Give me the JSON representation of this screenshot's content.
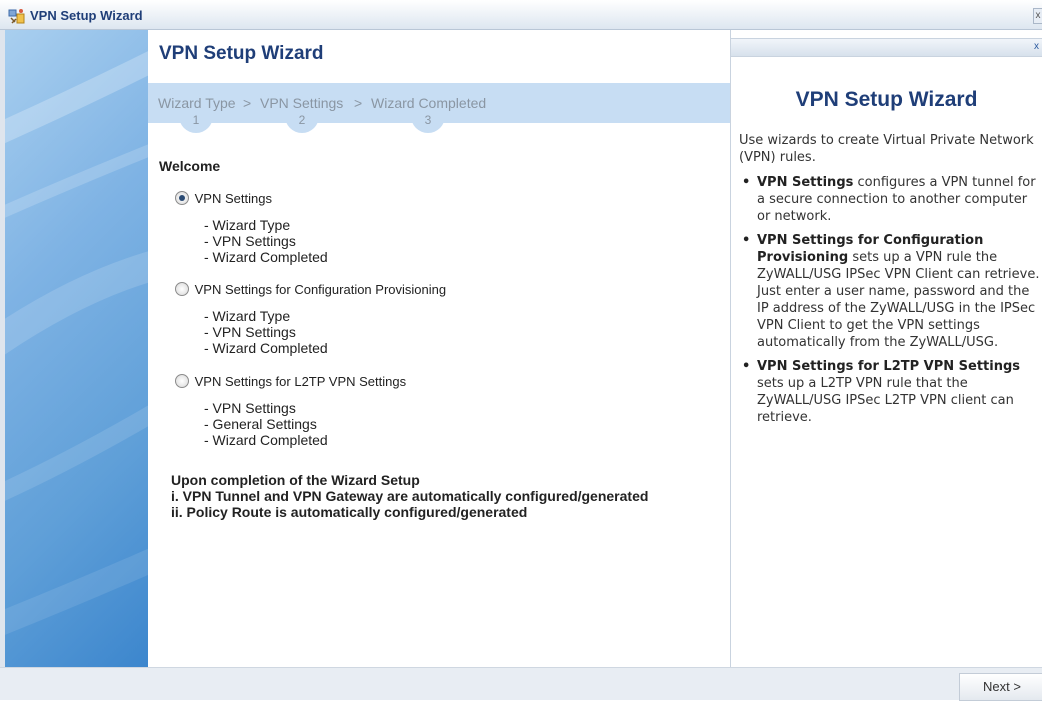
{
  "window": {
    "title": "VPN Setup Wizard",
    "close_glyph": "x"
  },
  "main": {
    "title": "VPN Setup Wizard",
    "steps": [
      {
        "label": "Wizard Type",
        "number": "1"
      },
      {
        "label": "VPN Settings",
        "number": "2"
      },
      {
        "label": "Wizard Completed",
        "number": "3"
      }
    ],
    "step_separator": ">",
    "welcome": "Welcome",
    "options": [
      {
        "label": "VPN Settings",
        "checked": true,
        "items": [
          "- Wizard Type",
          "- VPN Settings",
          "- Wizard Completed"
        ]
      },
      {
        "label": "VPN Settings for Configuration Provisioning",
        "checked": false,
        "items": [
          "- Wizard Type",
          "- VPN Settings",
          "- Wizard Completed"
        ]
      },
      {
        "label": "VPN Settings for L2TP VPN Settings",
        "checked": false,
        "items": [
          "- VPN Settings",
          "- General Settings",
          "- Wizard Completed"
        ]
      }
    ],
    "completion": [
      "Upon completion of the Wizard Setup",
      "i. VPN Tunnel and VPN Gateway are automatically configured/generated",
      "ii. Policy Route is automatically configured/generated"
    ]
  },
  "help": {
    "close_glyph": "x",
    "title": "VPN Setup Wizard",
    "intro": "Use wizards to create Virtual Private Network (VPN) rules.",
    "bullets": [
      {
        "term": "VPN Settings",
        "text": " configures a VPN tunnel for a secure connection to another computer or network."
      },
      {
        "term": "VPN Settings for Configuration Provisioning",
        "text": " sets up a VPN rule the ZyWALL/USG IPSec VPN Client can retrieve. Just enter a user name, password and the IP address of the ZyWALL/USG in the IPSec VPN Client to get the VPN settings automatically from the ZyWALL/USG."
      },
      {
        "term": "VPN Settings for L2TP VPN Settings",
        "text": " sets up a L2TP VPN rule that the ZyWALL/USG IPSec L2TP VPN client can retrieve."
      }
    ]
  },
  "footer": {
    "next_label": "Next >"
  },
  "icons": {
    "title_icon": "wizard-tools-icon"
  },
  "colors": {
    "title_blue": "#1f3e78",
    "step_bar": "#c7ddf3",
    "side_art": "#5f9fd8"
  }
}
